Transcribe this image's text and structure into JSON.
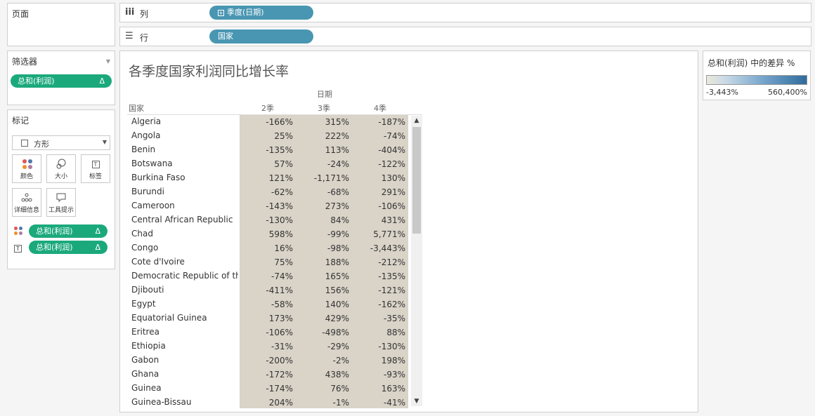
{
  "panels": {
    "pages_label": "页面",
    "filters_label": "筛选器",
    "filter_pill": "总和(利润)",
    "filter_delta": "Δ",
    "marks_label": "标记",
    "mark_type": "方形",
    "mark_buttons": [
      "颜色",
      "大小",
      "标签",
      "详细信息",
      "工具提示"
    ],
    "encodings": [
      {
        "icon": "color-dots-icon",
        "label": "总和(利润)",
        "delta": "Δ"
      },
      {
        "icon": "text-label-icon",
        "label": "总和(利润)",
        "delta": "Δ"
      }
    ]
  },
  "shelves": {
    "columns_label": "列",
    "columns_pill": "季度(日期)",
    "rows_label": "行",
    "rows_pill": "国家"
  },
  "viz": {
    "title": "各季度国家利润同比增长率",
    "date_header": "日期",
    "country_header": "国家",
    "quarters": [
      "2季",
      "3季",
      "4季"
    ],
    "rows": [
      {
        "country": "Algeria",
        "q2": "-166%",
        "q3": "315%",
        "q4": "-187%"
      },
      {
        "country": "Angola",
        "q2": "25%",
        "q3": "222%",
        "q4": "-74%"
      },
      {
        "country": "Benin",
        "q2": "-135%",
        "q3": "113%",
        "q4": "-404%"
      },
      {
        "country": "Botswana",
        "q2": "57%",
        "q3": "-24%",
        "q4": "-122%"
      },
      {
        "country": "Burkina Faso",
        "q2": "121%",
        "q3": "-1,171%",
        "q4": "130%"
      },
      {
        "country": "Burundi",
        "q2": "-62%",
        "q3": "-68%",
        "q4": "291%"
      },
      {
        "country": "Cameroon",
        "q2": "-143%",
        "q3": "273%",
        "q4": "-106%"
      },
      {
        "country": "Central African Republic",
        "q2": "-130%",
        "q3": "84%",
        "q4": "431%"
      },
      {
        "country": "Chad",
        "q2": "598%",
        "q3": "-99%",
        "q4": "5,771%"
      },
      {
        "country": "Congo",
        "q2": "16%",
        "q3": "-98%",
        "q4": "-3,443%"
      },
      {
        "country": "Cote d'Ivoire",
        "q2": "75%",
        "q3": "188%",
        "q4": "-212%"
      },
      {
        "country": "Democratic Republic of th..",
        "q2": "-74%",
        "q3": "165%",
        "q4": "-135%"
      },
      {
        "country": "Djibouti",
        "q2": "-411%",
        "q3": "156%",
        "q4": "-121%"
      },
      {
        "country": "Egypt",
        "q2": "-58%",
        "q3": "140%",
        "q4": "-162%"
      },
      {
        "country": "Equatorial Guinea",
        "q2": "173%",
        "q3": "429%",
        "q4": "-35%"
      },
      {
        "country": "Eritrea",
        "q2": "-106%",
        "q3": "-498%",
        "q4": "88%"
      },
      {
        "country": "Ethiopia",
        "q2": "-31%",
        "q3": "-29%",
        "q4": "-130%"
      },
      {
        "country": "Gabon",
        "q2": "-200%",
        "q3": "-2%",
        "q4": "198%"
      },
      {
        "country": "Ghana",
        "q2": "-172%",
        "q3": "438%",
        "q4": "-93%"
      },
      {
        "country": "Guinea",
        "q2": "-174%",
        "q3": "76%",
        "q4": "163%"
      },
      {
        "country": "Guinea-Bissau",
        "q2": "204%",
        "q3": "-1%",
        "q4": "-41%"
      }
    ]
  },
  "legend": {
    "title": "总和(利润) 中的差异 %",
    "min": "-3,443%",
    "max": "560,400%"
  },
  "colors": {
    "cell_base": "#d9d3c8",
    "pill_green": "#1ba97c",
    "pill_blue": "#4996b2"
  }
}
